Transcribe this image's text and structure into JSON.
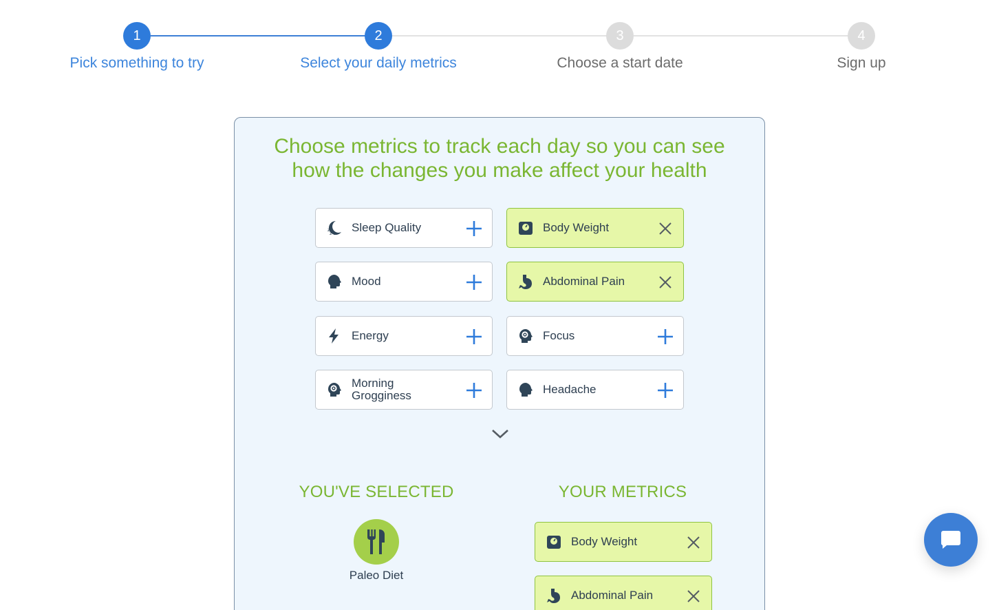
{
  "stepper": {
    "steps": [
      {
        "number": "1",
        "label": "Pick something to try",
        "state": "done"
      },
      {
        "number": "2",
        "label": "Select your daily metrics",
        "state": "active"
      },
      {
        "number": "3",
        "label": "Choose a start date",
        "state": "inactive"
      },
      {
        "number": "4",
        "label": "Sign up",
        "state": "inactive"
      }
    ]
  },
  "panel": {
    "heading_line1": "Choose metrics to track each day so you can see",
    "heading_line2": "how the changes you make affect your health",
    "metrics": [
      {
        "label": "Sleep Quality",
        "icon": "sleep-icon",
        "selected": false,
        "action": "add"
      },
      {
        "label": "Body Weight",
        "icon": "scale-icon",
        "selected": true,
        "action": "remove"
      },
      {
        "label": "Mood",
        "icon": "head-icon",
        "selected": false,
        "action": "add"
      },
      {
        "label": "Abdominal Pain",
        "icon": "stomach-icon",
        "selected": true,
        "action": "remove"
      },
      {
        "label": "Energy",
        "icon": "bolt-icon",
        "selected": false,
        "action": "add"
      },
      {
        "label": "Focus",
        "icon": "brain-gear-icon",
        "selected": false,
        "action": "add"
      },
      {
        "label": "Morning Grogginess",
        "icon": "brain-gear-icon",
        "selected": false,
        "action": "add"
      },
      {
        "label": "Headache",
        "icon": "head-icon",
        "selected": false,
        "action": "add"
      }
    ],
    "expand_icon": "chevron-down-icon"
  },
  "selected_section": {
    "title": "YOU'VE SELECTED",
    "item_label": "Paleo Diet",
    "item_icon": "fork-knife-icon"
  },
  "your_metrics_section": {
    "title": "YOUR METRICS",
    "items": [
      {
        "label": "Body Weight",
        "icon": "scale-icon"
      },
      {
        "label": "Abdominal Pain",
        "icon": "stomach-icon"
      }
    ]
  },
  "chat": {
    "icon": "chat-bubble-icon"
  },
  "colors": {
    "primary_blue": "#2e7bdb",
    "accent_green": "#7ab632",
    "selected_fill": "#e6f7a8",
    "panel_bg": "#eef6fd"
  }
}
